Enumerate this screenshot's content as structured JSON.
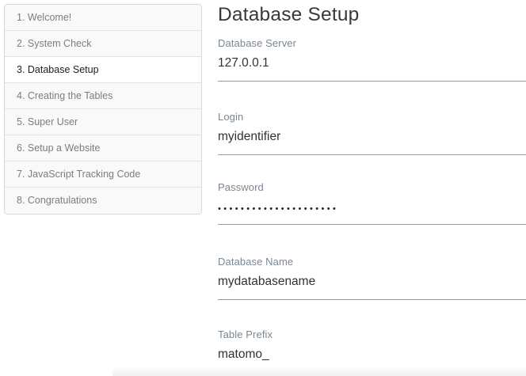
{
  "page": {
    "title": "Database Setup"
  },
  "sidebar": {
    "items": [
      {
        "label": "1. Welcome!",
        "active": false
      },
      {
        "label": "2. System Check",
        "active": false
      },
      {
        "label": "3. Database Setup",
        "active": true
      },
      {
        "label": "4. Creating the Tables",
        "active": false
      },
      {
        "label": "5. Super User",
        "active": false
      },
      {
        "label": "6. Setup a Website",
        "active": false
      },
      {
        "label": "7. JavaScript Tracking Code",
        "active": false
      },
      {
        "label": "8. Congratulations",
        "active": false
      }
    ]
  },
  "form": {
    "fields": [
      {
        "label": "Database Server",
        "value": "127.0.0.1",
        "type": "text"
      },
      {
        "label": "Login",
        "value": "myidentifier",
        "type": "text"
      },
      {
        "label": "Password",
        "value": "•••••••••••••••••••••",
        "type": "password"
      },
      {
        "label": "Database Name",
        "value": "mydatabasename",
        "type": "text"
      },
      {
        "label": "Table Prefix",
        "value": "matomo_",
        "type": "text"
      }
    ]
  },
  "colors": {
    "accent_active_text": "#1d1d1d",
    "sidebar_inactive_bg": "#f9f9f9",
    "label_gray": "#7c8691",
    "underline_gray": "#9a9a9a"
  }
}
